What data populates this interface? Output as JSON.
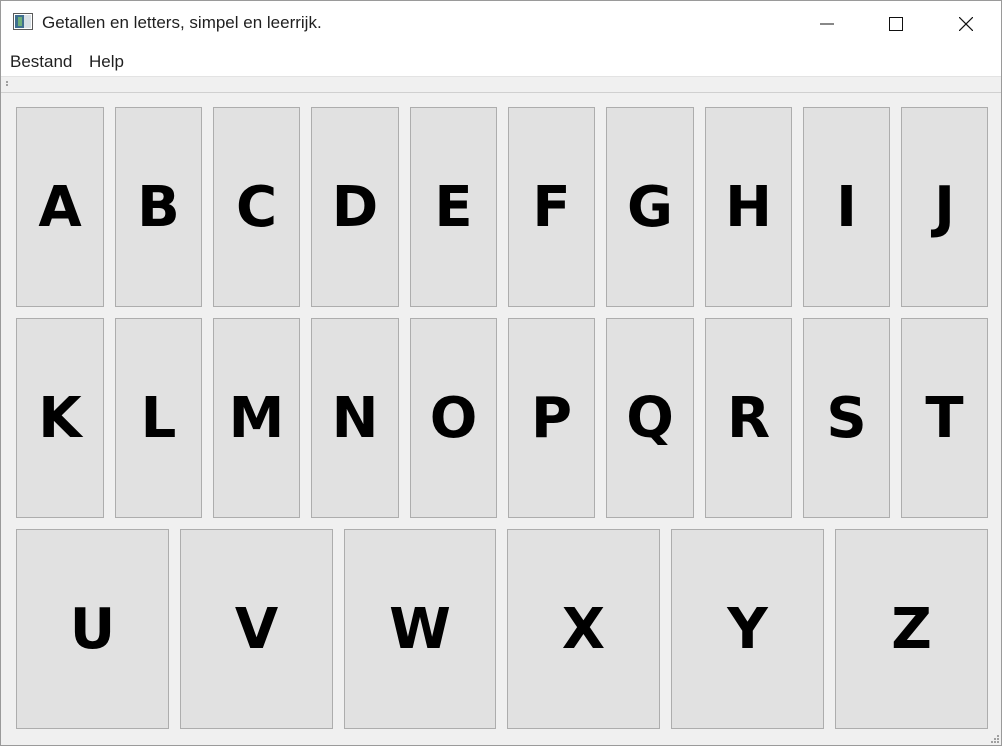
{
  "window": {
    "title": "Getallen en letters, simpel en leerrijk.",
    "controls": {
      "minimize": "minimize-icon",
      "maximize": "maximize-icon",
      "close": "close-icon"
    }
  },
  "menu": {
    "items": [
      {
        "label": "Bestand"
      },
      {
        "label": "Help"
      }
    ]
  },
  "keys": {
    "row1": [
      "A",
      "B",
      "C",
      "D",
      "E",
      "F",
      "G",
      "H",
      "I",
      "J"
    ],
    "row2": [
      "K",
      "L",
      "M",
      "N",
      "O",
      "P",
      "Q",
      "R",
      "S",
      "T"
    ],
    "row3": [
      "U",
      "V",
      "W",
      "X",
      "Y",
      "Z"
    ]
  }
}
